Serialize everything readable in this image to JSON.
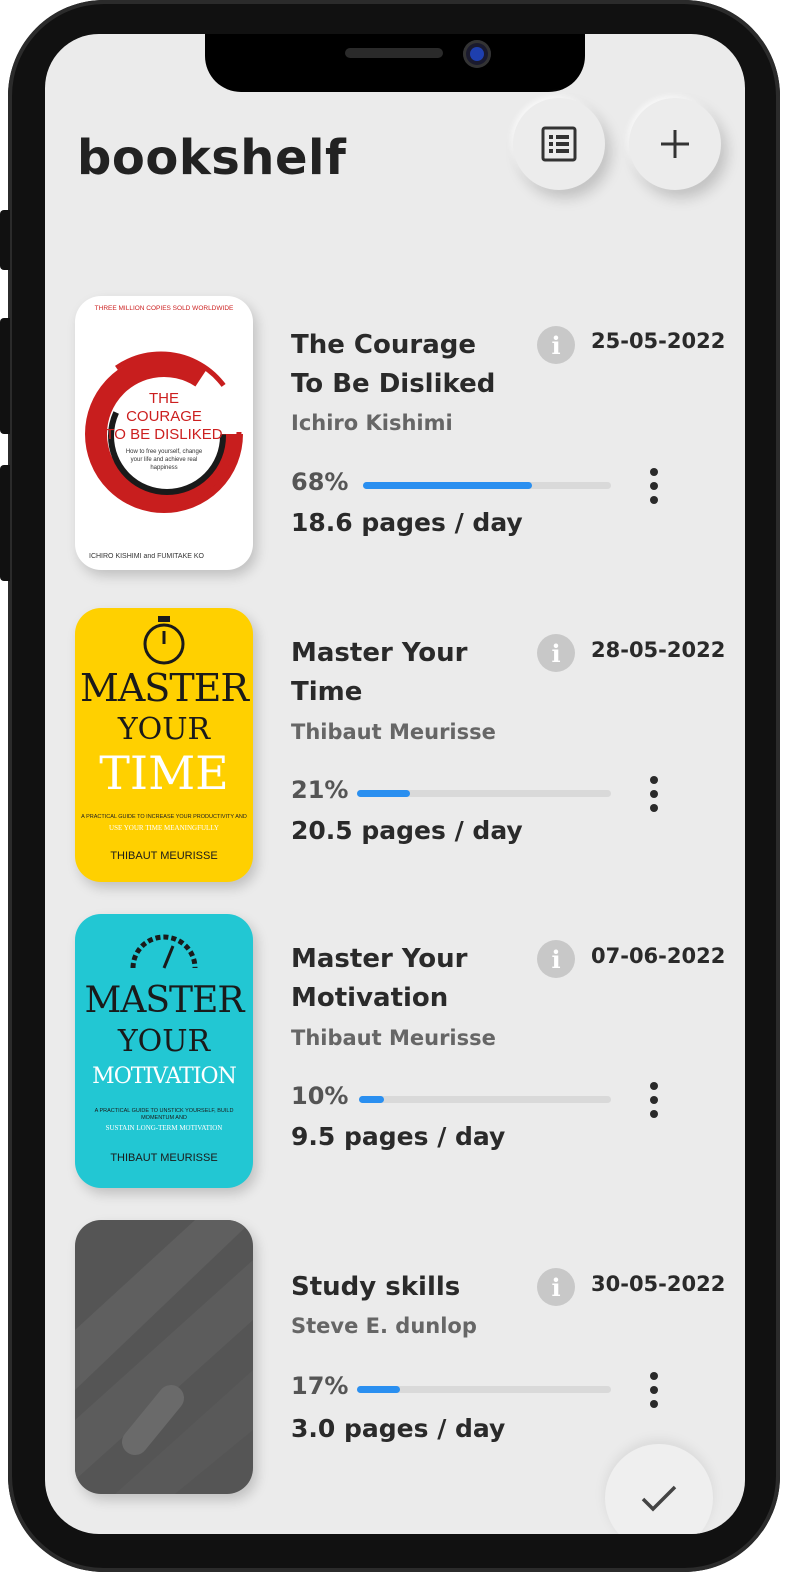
{
  "app": {
    "title": "bookshelf"
  },
  "header": {
    "list_icon": "list-view-icon",
    "add_icon": "plus-icon"
  },
  "books": [
    {
      "title_line1": "The Courage",
      "title_line2": "To Be Disliked",
      "author": "Ichiro Kishimi",
      "date": "25-05-2022",
      "progress_label": "68%",
      "progress": 0.68,
      "rate": "18.6 pages / day",
      "cover": {
        "top_text": "THREE MILLION COPIES SOLD WORLDWIDE",
        "line1": "THE",
        "line2": "COURAGE",
        "line3": "TO BE DISLIKED",
        "subtitle": "How to free yourself, change your life and achieve real happiness",
        "authors": "ICHIRO KISHIMI and FUMITAKE KO",
        "bg": "#ffffff",
        "accent": "#cc1f1f"
      }
    },
    {
      "title_line1": "Master Your",
      "title_line2": "Time",
      "author": "Thibaut Meurisse",
      "date": "28-05-2022",
      "progress_label": "21%",
      "progress": 0.21,
      "rate": "20.5 pages / day",
      "cover": {
        "line1": "MASTER",
        "line2": "YOUR",
        "line3": "TIME",
        "subtitle_a": "A PRACTICAL GUIDE TO INCREASE YOUR PRODUCTIVITY AND",
        "subtitle_b": "USE YOUR TIME MEANINGFULLY",
        "author": "THIBAUT MEURISSE",
        "bg": "#ffd000"
      }
    },
    {
      "title_line1": "Master Your",
      "title_line2": "Motivation",
      "author": "Thibaut Meurisse",
      "date": "07-06-2022",
      "progress_label": "10%",
      "progress": 0.1,
      "rate": "9.5 pages / day",
      "cover": {
        "line1": "MASTER",
        "line2": "YOUR",
        "line3": "MOTIVATION",
        "subtitle_a": "A PRACTICAL GUIDE TO UNSTICK YOURSELF, BUILD MOMENTUM AND",
        "subtitle_b": "SUSTAIN LONG-TERM MOTIVATION",
        "author": "THIBAUT MEURISSE",
        "bg": "#22c7d3"
      }
    },
    {
      "title_line1": "Study skills",
      "author": "Steve E. dunlop",
      "date": "30-05-2022",
      "progress_label": "17%",
      "progress": 0.17,
      "rate": "3.0 pages / day",
      "cover": {
        "bg": "#555555"
      }
    }
  ],
  "fab": {
    "icon": "check-icon"
  }
}
